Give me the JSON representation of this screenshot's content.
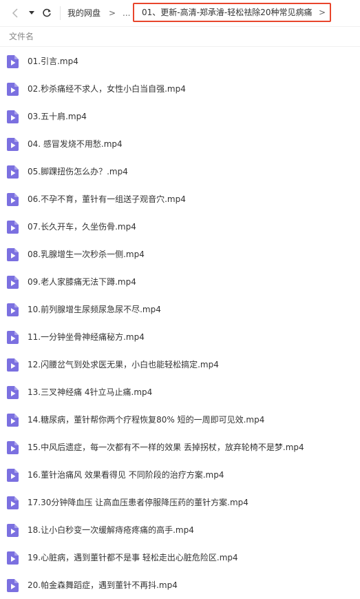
{
  "toolbar": {
    "back_icon": "chevron-left-icon",
    "dropdown_icon": "caret-down-icon",
    "refresh_icon": "refresh-icon"
  },
  "breadcrumb": {
    "home": "我的网盘",
    "separator": ">",
    "ellipsis": "...",
    "current": "01、更新-高清-郑承濬-轻松祛除20种常见病痛"
  },
  "header": {
    "column_label": "文件名"
  },
  "colors": {
    "file_icon": "#7b70e0",
    "highlight_border": "#e8452c"
  },
  "files": [
    {
      "name": "01.引言.mp4"
    },
    {
      "name": "02.秒杀痛经不求人，女性小白当自强.mp4"
    },
    {
      "name": "03.五十肩.mp4"
    },
    {
      "name": "04. 感冒发烧不用愁.mp4"
    },
    {
      "name": "05.脚踝扭伤怎么办？.mp4"
    },
    {
      "name": "06.不孕不育，董针有一组送子观音穴.mp4"
    },
    {
      "name": "07.长久开车，久坐伤骨.mp4"
    },
    {
      "name": "08.乳腺增生一次秒杀一侧.mp4"
    },
    {
      "name": "09.老人家膝痛无法下蹲.mp4"
    },
    {
      "name": "10.前列腺增生尿频尿急尿不尽.mp4"
    },
    {
      "name": "11.一分钟坐骨神经痛秘方.mp4"
    },
    {
      "name": "12.闪腰岔气到处求医无果，小白也能轻松搞定.mp4"
    },
    {
      "name": "13.三叉神经痛 4针立马止痛.mp4"
    },
    {
      "name": "14.糖尿病，董针帮你两个疗程恢复80% 短的一周即可见效.mp4"
    },
    {
      "name": "15.中风后遗症，每一次都有不一样的效果 丢掉拐杖，放弃轮椅不是梦.mp4"
    },
    {
      "name": "16.董针治痛风 效果看得见 不同阶段的治疗方案.mp4"
    },
    {
      "name": "17.30分钟降血压 让高血压患者停服降压药的董针方案.mp4"
    },
    {
      "name": "18.让小白秒变一次缓解痔疮疼痛的高手.mp4"
    },
    {
      "name": "19.心脏病，遇到董针都不是事 轻松走出心脏危险区.mp4"
    },
    {
      "name": "20.帕金森舞蹈症，遇到董针不再抖.mp4"
    }
  ]
}
